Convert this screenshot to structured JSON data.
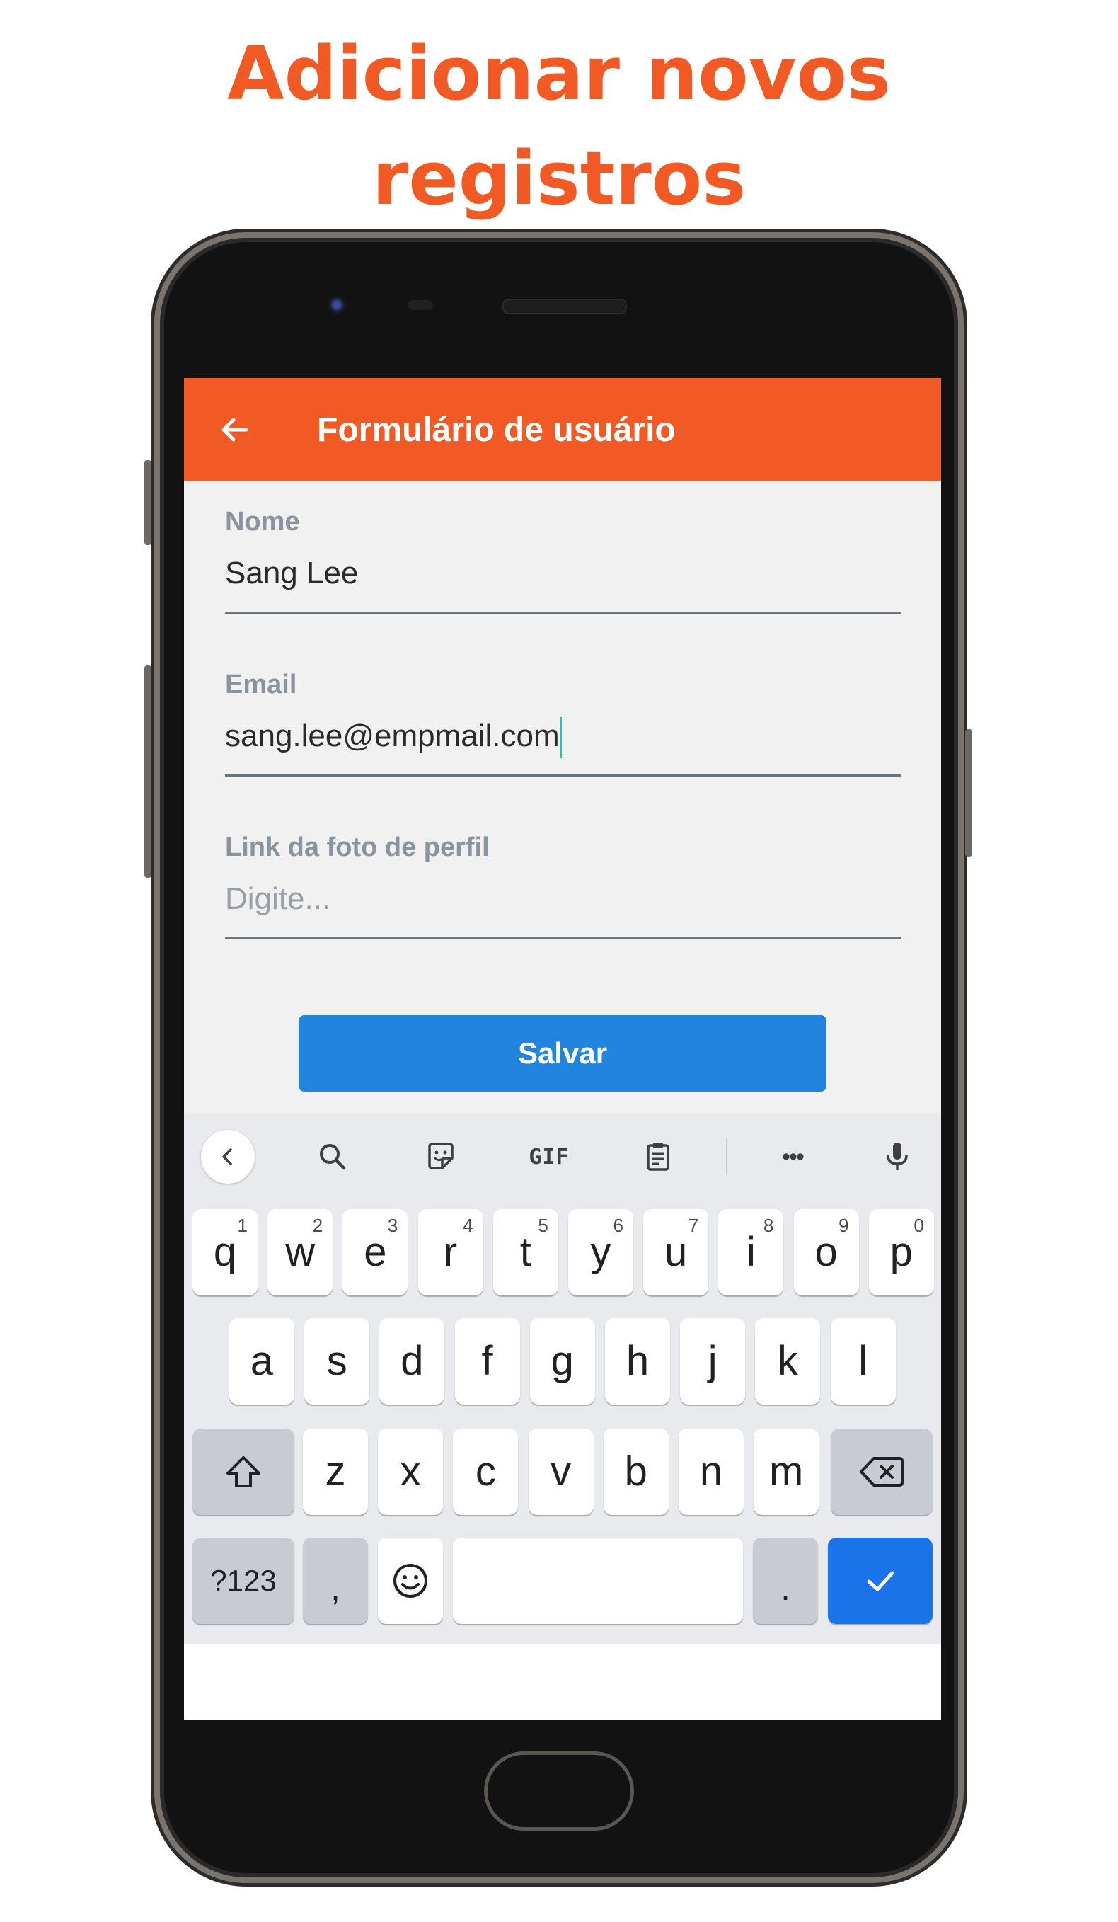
{
  "headline": {
    "line1": "Adicionar novos",
    "line2": "registros"
  },
  "appbar": {
    "back_icon": "arrow-left-icon",
    "title": "Formulário de usuário"
  },
  "form": {
    "fields": [
      {
        "label": "Nome",
        "value": "Sang Lee",
        "placeholder": ""
      },
      {
        "label": "Email",
        "value": "sang.lee@empmail.com",
        "placeholder": "",
        "focused": true
      },
      {
        "label": "Link da foto de perfil",
        "value": "",
        "placeholder": "Digite..."
      }
    ],
    "save_label": "Salvar"
  },
  "keyboard": {
    "toolbar": {
      "back": "chevron-left-icon",
      "search": "search-icon",
      "sticker": "sticker-icon",
      "gif": "GIF",
      "clipboard": "clipboard-icon",
      "more": "•••",
      "mic": "microphone-icon"
    },
    "row1": [
      {
        "key": "q",
        "hint": "1"
      },
      {
        "key": "w",
        "hint": "2"
      },
      {
        "key": "e",
        "hint": "3"
      },
      {
        "key": "r",
        "hint": "4"
      },
      {
        "key": "t",
        "hint": "5"
      },
      {
        "key": "y",
        "hint": "6"
      },
      {
        "key": "u",
        "hint": "7"
      },
      {
        "key": "i",
        "hint": "8"
      },
      {
        "key": "o",
        "hint": "9"
      },
      {
        "key": "p",
        "hint": "0"
      }
    ],
    "row2": [
      "a",
      "s",
      "d",
      "f",
      "g",
      "h",
      "j",
      "k",
      "l"
    ],
    "row3": [
      "z",
      "x",
      "c",
      "v",
      "b",
      "n",
      "m"
    ],
    "row4": {
      "symbols": "?123",
      "comma": ",",
      "period": ".",
      "emoji_icon": "emoji-icon",
      "enter_icon": "checkmark-icon"
    },
    "shift_icon": "shift-icon",
    "backspace_icon": "backspace-icon"
  },
  "colors": {
    "accent": "#F15A24",
    "button": "#2185E0",
    "enter_key": "#1A73E8",
    "caret": "#1EC8B4"
  }
}
